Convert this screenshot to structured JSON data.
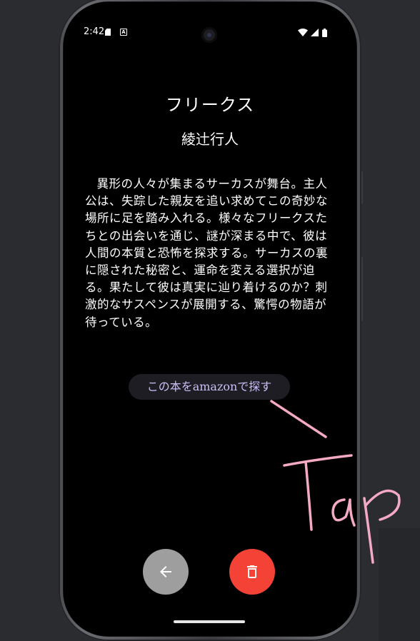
{
  "status_bar": {
    "time": "2:42",
    "sd_icon": "sd-card-icon",
    "a_icon_label": "A",
    "wifi_icon": "wifi-icon",
    "signal_icon": "signal-icon",
    "battery_icon": "battery-icon"
  },
  "book": {
    "title": "フリークス",
    "author": "綾辻行人",
    "description": "異形の人々が集まるサーカスが舞台。主人公は、失踪した親友を追い求めてこの奇妙な場所に足を踏み入れる。様々なフリークスたちとの出会いを通じ、謎が深まる中で、彼は人間の本質と恐怖を探求する。サーカスの裏に隠された秘密と、運命を変える選択が迫る。果たして彼は真実に辿り着けるのか？刺激的なサスペンスが展開する、驚愕の物語が待っている。"
  },
  "actions": {
    "amazon_button_label": "この本をamazonで探す",
    "back_icon": "arrow-left-icon",
    "delete_icon": "trash-icon"
  },
  "annotation": {
    "text": "Tap"
  },
  "colors": {
    "background": "#000000",
    "frame_background": "#2b2c30",
    "amazon_button_bg": "#1e1d24",
    "amazon_button_text": "#cbbdf6",
    "back_fab": "#9e9e9e",
    "delete_fab": "#f44336",
    "annotation": "#f4a9c4"
  }
}
